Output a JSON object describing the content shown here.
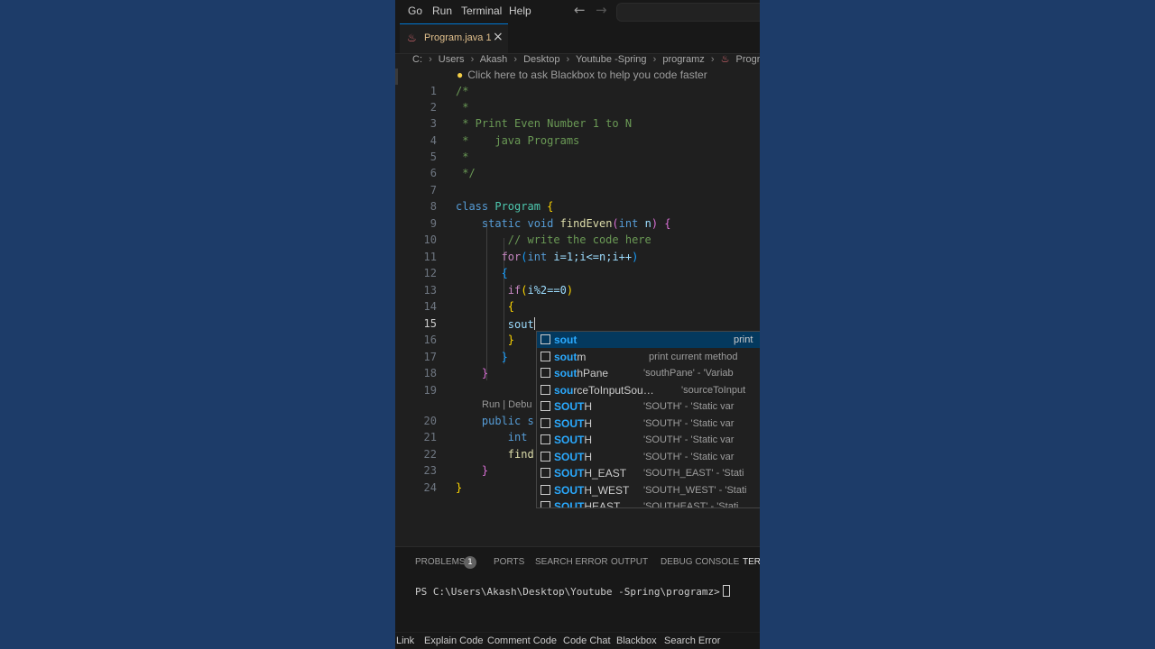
{
  "menubar": {
    "items": [
      "Go",
      "Run",
      "Terminal",
      "Help"
    ],
    "back_arrow": "arrow-left-icon",
    "forward_arrow": "arrow-right-icon"
  },
  "tab": {
    "filename": "Program.java",
    "problem_count": "1",
    "close": "×"
  },
  "breadcrumb": [
    "C:",
    "Users",
    "Akash",
    "Desktop",
    "Youtube -Spring",
    "programz",
    "Program.java"
  ],
  "hint": "Click here to ask Blackbox to help you code faster",
  "editor": {
    "active_line": 15,
    "lines": [
      {
        "n": "1"
      },
      {
        "n": "2"
      },
      {
        "n": "3"
      },
      {
        "n": "4"
      },
      {
        "n": "5"
      },
      {
        "n": "6"
      },
      {
        "n": "7"
      },
      {
        "n": "8"
      },
      {
        "n": "9"
      },
      {
        "n": "10"
      },
      {
        "n": "11"
      },
      {
        "n": "12"
      },
      {
        "n": "13"
      },
      {
        "n": "14"
      },
      {
        "n": "15"
      },
      {
        "n": "16"
      },
      {
        "n": "17"
      },
      {
        "n": "18"
      },
      {
        "n": "19"
      },
      {
        "n": "20"
      },
      {
        "n": "21"
      },
      {
        "n": "22"
      },
      {
        "n": "23"
      },
      {
        "n": "24"
      }
    ],
    "code": {
      "l1": "/*",
      "l2": " *",
      "l3": " * Print Even Number 1 to N",
      "l4": " *    java Programs",
      "l5": " *",
      "l6": " */",
      "l8_kw": "class",
      "l8_cls": "Program",
      "l9_kw": "static void",
      "l9_fn": "findEven",
      "l9_type": "int",
      "l9_param": "n",
      "l10": "// write the code here",
      "l11_kw": "for",
      "l11_type": "int",
      "l11_rest": "i=1;i<=n;i++",
      "l13_kw": "if",
      "l13_rest": "i%2==0",
      "l15": "sout",
      "codelens": "Run | Debu",
      "l20_kw": "public s",
      "l21": "int",
      "l22": "find"
    }
  },
  "suggest": [
    {
      "match": "sout",
      "rest": "",
      "detail": "print",
      "selected": true
    },
    {
      "match": "sout",
      "rest": "m",
      "detail": "print current method",
      "selected": false
    },
    {
      "match": "sout",
      "rest": "hPane",
      "detail": "'southPane' - 'Variab",
      "selected": false
    },
    {
      "match": "sou",
      "rest": "rceToInputSou…",
      "detail": "'sourceToInput",
      "selected": false
    },
    {
      "match": "SOUT",
      "rest": "H",
      "detail": "'SOUTH' - 'Static var",
      "selected": false
    },
    {
      "match": "SOUT",
      "rest": "H",
      "detail": "'SOUTH' - 'Static var",
      "selected": false
    },
    {
      "match": "SOUT",
      "rest": "H",
      "detail": "'SOUTH' - 'Static var",
      "selected": false
    },
    {
      "match": "SOUT",
      "rest": "H",
      "detail": "'SOUTH' - 'Static var",
      "selected": false
    },
    {
      "match": "SOUT",
      "rest": "H_EAST",
      "detail": "'SOUTH_EAST' - 'Stati",
      "selected": false
    },
    {
      "match": "SOUT",
      "rest": "H_WEST",
      "detail": "'SOUTH_WEST' - 'Stati",
      "selected": false
    },
    {
      "match": "SOUT",
      "rest": "HEAST",
      "detail": "'SOUTHEAST' - 'Stati",
      "selected": false
    }
  ],
  "panel": {
    "tabs": [
      "PROBLEMS",
      "PORTS",
      "SEARCH ERROR",
      "OUTPUT",
      "DEBUG CONSOLE",
      "TERMI"
    ],
    "problems_badge": "1",
    "terminal_prompt": "PS C:\\Users\\Akash\\Desktop\\Youtube -Spring\\programz>"
  },
  "statusbar": [
    "Link",
    "Explain Code",
    "Comment Code",
    "Code Chat",
    "Blackbox",
    "Search Error"
  ],
  "colors": {
    "accent": "#0078d4",
    "background": "#1b3a66",
    "editor_bg": "#1f1f1f"
  }
}
